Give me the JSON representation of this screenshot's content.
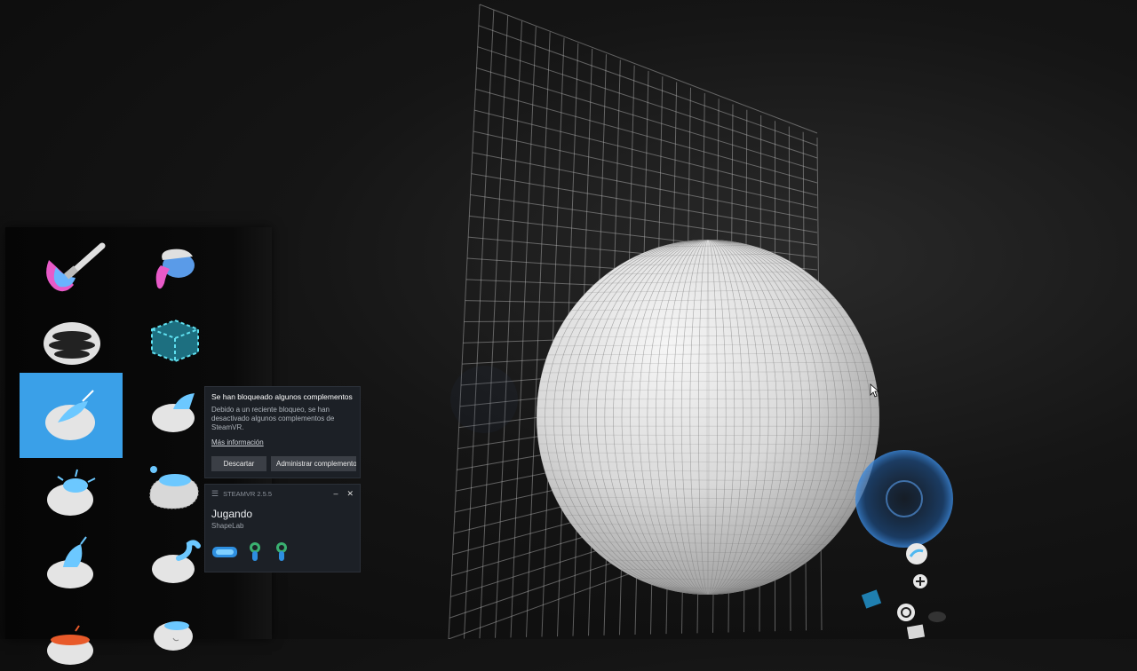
{
  "app": {
    "name": "ShapeLab",
    "overlay": "SteamVR"
  },
  "tool_palette": {
    "tools": [
      {
        "name": "paint-brush",
        "selected": false
      },
      {
        "name": "paint-bucket",
        "selected": false
      },
      {
        "name": "layers",
        "selected": false
      },
      {
        "name": "box-primitive",
        "selected": false
      },
      {
        "name": "clay-brush",
        "selected": true
      },
      {
        "name": "move-brush",
        "selected": false
      },
      {
        "name": "inflate-brush",
        "selected": false
      },
      {
        "name": "smooth-brush",
        "selected": false
      },
      {
        "name": "pull-brush",
        "selected": false
      },
      {
        "name": "twist-brush",
        "selected": false
      },
      {
        "name": "cut-brush",
        "selected": false
      },
      {
        "name": "flatten-brush",
        "selected": false
      }
    ]
  },
  "notification": {
    "title": "Se han bloqueado algunos complementos",
    "body": "Debido a un reciente bloqueo, se han desactivado algunos complementos de SteamVR.",
    "link": "Más información",
    "dismiss_label": "Descartar",
    "manage_label": "Administrar complementos"
  },
  "steamvr": {
    "version": "STEAMVR 2.5.5",
    "minimize": "–",
    "close": "✕",
    "status": "Jugando",
    "game": "ShapeLab",
    "devices": [
      "headset-icon",
      "controller-icon",
      "controller-icon"
    ]
  },
  "colors": {
    "accent": "#3aa0e8",
    "panel_bg": "#1c2026",
    "button_bg": "#3b3f46",
    "sphere": "#e6e6e6"
  }
}
